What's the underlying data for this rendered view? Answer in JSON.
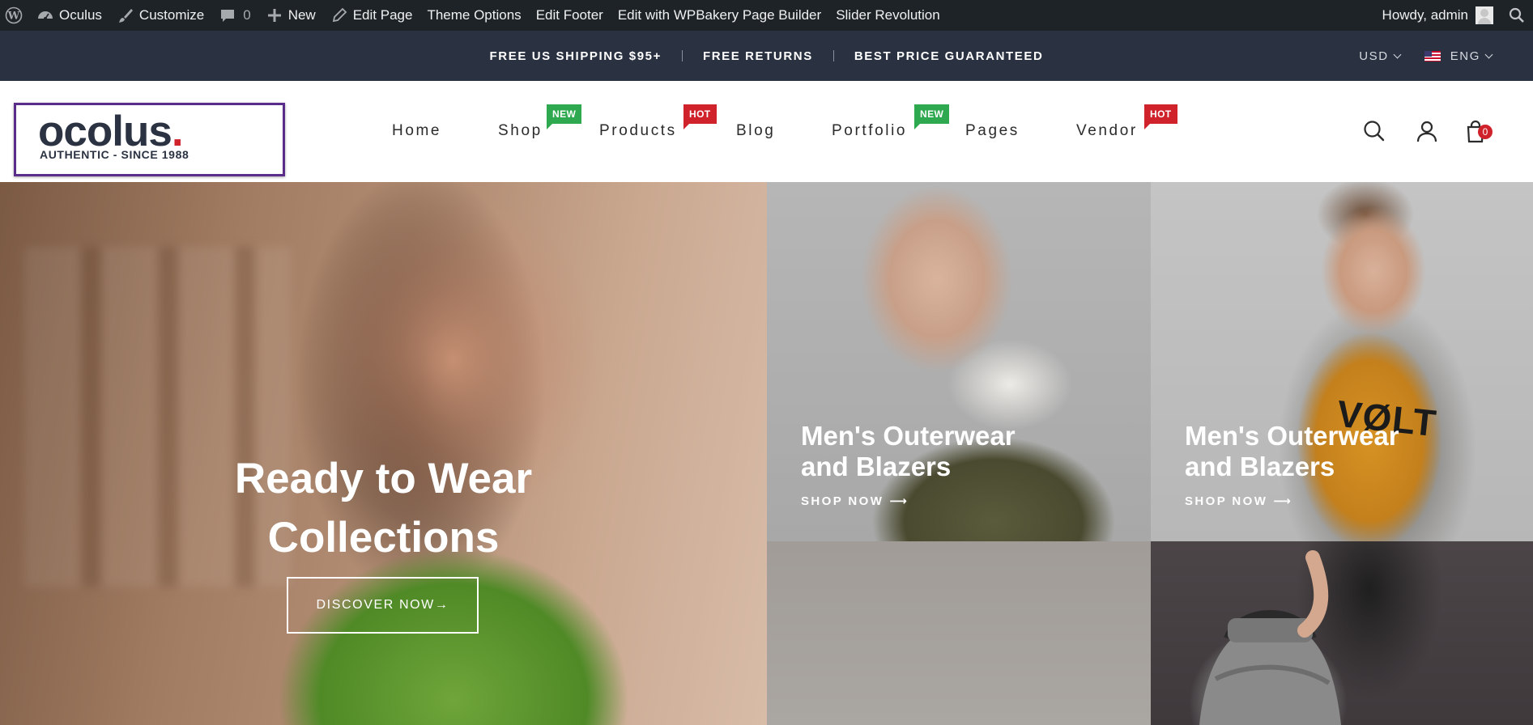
{
  "admin_bar": {
    "site_name": "Oculus",
    "customize": "Customize",
    "comments_count": "0",
    "new": "New",
    "edit_page": "Edit Page",
    "theme_options": "Theme Options",
    "edit_footer": "Edit Footer",
    "wpbakery": "Edit with WPBakery Page Builder",
    "slider_revolution": "Slider Revolution",
    "greeting": "Howdy, admin"
  },
  "promo_bar": {
    "messages": [
      "FREE US SHIPPING $95+",
      "FREE RETURNS",
      "BEST PRICE GUARANTEED"
    ],
    "currency": "USD",
    "language": "ENG"
  },
  "header": {
    "logo_text": "ocolus",
    "logo_dot": ".",
    "logo_tagline": "AUTHENTIC - SINCE 1988",
    "nav": [
      {
        "label": "Home"
      },
      {
        "label": "Shop",
        "badge": "NEW"
      },
      {
        "label": "Products",
        "badge": "HOT"
      },
      {
        "label": "Blog"
      },
      {
        "label": "Portfolio",
        "badge": "NEW"
      },
      {
        "label": "Pages"
      },
      {
        "label": "Vendor",
        "badge": "HOT"
      }
    ],
    "cart_count": "0",
    "icons": [
      "search-icon",
      "user-icon",
      "shopping-bag-icon"
    ]
  },
  "hero": {
    "title_line1": "Ready to Wear",
    "title_line2": "Collections",
    "cta": "DISCOVER NOW→"
  },
  "tiles": [
    {
      "title_line1": "Men's Outerwear",
      "title_line2": "and Blazers",
      "cta": "SHOP NOW"
    },
    {
      "title_line1": "Men's Outerwear",
      "title_line2": "and Blazers",
      "cta": "SHOP NOW"
    }
  ],
  "colors": {
    "admin_bar_bg": "#1d2327",
    "promo_bg": "#2a3242",
    "badge_new": "#2ea94f",
    "badge_hot": "#d0222b",
    "logo_border": "#5b2d8a"
  }
}
